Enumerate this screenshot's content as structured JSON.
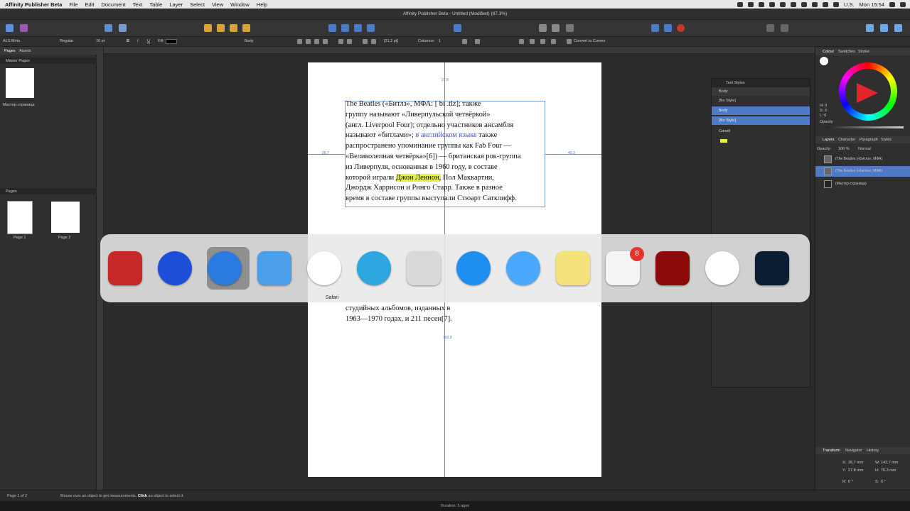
{
  "menubar": {
    "app": "Affinity Publisher Beta",
    "items": [
      "File",
      "Edit",
      "Document",
      "Text",
      "Table",
      "Layer",
      "Select",
      "View",
      "Window",
      "Help"
    ],
    "status_lang": "U.S.",
    "clock": "Mon 15:54"
  },
  "window": {
    "title": "Affinity Publisher Beta - Untitled (Modified) (87.3%)"
  },
  "context": {
    "font": "ALS Mirta",
    "style": "Regular",
    "size": "16 pt",
    "bold": "B",
    "italic": "I",
    "underline": "U",
    "fill_label": "Fill:",
    "paragraph_style": "Body",
    "leading": "[21,2 pt]",
    "columns_label": "Columns:",
    "columns_value": "1",
    "convert": "Convert to Curves"
  },
  "left_panel": {
    "tabs": [
      "Pages",
      "Assets"
    ],
    "master_section": "Master Pages",
    "master_label": "Мастер-страница",
    "pages_section": "Pages",
    "pages": [
      "Page 1",
      "Page 2"
    ]
  },
  "document": {
    "text_lines": [
      "The Beatles («Битлз», МФА: [         bi     .tlz]; также",
      "группу называют «Ливерпульской четвёркой»",
      "(англ. Liverpool Four); отдельно участников ансамбля"
    ],
    "line4_a": "называют «битлами»; ",
    "line4_link": "в английском языке",
    "line4_b": " также",
    "text_lines_2": [
      "распространено упоминание группы как Fab Four —",
      "«Великолепная четвёрка»[6]) — британская рок-группа",
      "из Ливерпуля, основанная в 1960 году, в составе"
    ],
    "line8_a": "которой играли ",
    "line8_hl": "Джон Леннон,",
    "line8_b": " Пол Маккартни,",
    "text_lines_3": [
      "Джордж Харрисон и Ринго Старр. Также в разное",
      "время в составе группы выступали Стюарт Сатклифф."
    ],
    "text_lines_lower": [
      "студийных альбомов, изданных в",
      "1963—1970 годах, и 211 песен[7]."
    ],
    "meas_top": "27,8",
    "meas_left": "26,7",
    "meas_right": "40,3",
    "meas_bottom": "192,9"
  },
  "text_styles_panel": {
    "title": "Text Styles",
    "rows": [
      "Body",
      "[No Style]",
      "Body",
      "[No Style]",
      "Синий"
    ]
  },
  "right_panel": {
    "tabs_top": [
      "Colour",
      "Swatches",
      "Stroke"
    ],
    "hsl": [
      "H: 0",
      "S: 0",
      "L: 0"
    ],
    "opacity_label": "Opacity",
    "layer_tabs": [
      "Layers",
      "Character",
      "Paragraph",
      "Styles"
    ],
    "opacity": "Opacity:",
    "opacity_value": "100 %",
    "blend": "Normal",
    "layers": [
      "(The Beatles («Битлз», МФА)",
      "(The Beatles («Битлз», МФА)",
      "(Мастер-страница)"
    ],
    "transform_tabs": [
      "Transform",
      "Navigator",
      "History"
    ],
    "x_label": "X:",
    "x_val": "26,7 mm",
    "y_label": "Y:",
    "y_val": "27,8 mm",
    "w_label": "W:",
    "w_val": "142,7 mm",
    "h_label": "H:",
    "h_val": "76,3 mm",
    "r_label": "R:",
    "r_val": "0 °",
    "s_label": "S:",
    "s_val": "0 °"
  },
  "status": {
    "page": "Page 1 of 2",
    "hint_a": "Mouse over an object to get measurements. ",
    "hint_click": "Click",
    "hint_b": " an object to select it."
  },
  "bottom": {
    "caption": "Duration: 5 ages"
  },
  "switcher": {
    "selected_label": "Safari",
    "badge": "8",
    "apps": [
      {
        "name": "affinity-publisher-beta",
        "color": "#c62828"
      },
      {
        "name": "video-editor",
        "color": "#1d4ed8"
      },
      {
        "name": "safari",
        "color": "#2a7be0"
      },
      {
        "name": "finder",
        "color": "#4a9fe8"
      },
      {
        "name": "itunes",
        "color": "#ffffff"
      },
      {
        "name": "telegram",
        "color": "#2ea6e0"
      },
      {
        "name": "mail",
        "color": "#d9d9d9"
      },
      {
        "name": "app-store",
        "color": "#1f8ef1"
      },
      {
        "name": "messages",
        "color": "#4aa8ff"
      },
      {
        "name": "notes",
        "color": "#f5e27a"
      },
      {
        "name": "reminders",
        "color": "#f4f4f4"
      },
      {
        "name": "adobe-acrobat",
        "color": "#8b0b0b"
      },
      {
        "name": "w-app",
        "color": "#ffffff"
      },
      {
        "name": "photoshop",
        "color": "#0a1d33"
      }
    ]
  }
}
